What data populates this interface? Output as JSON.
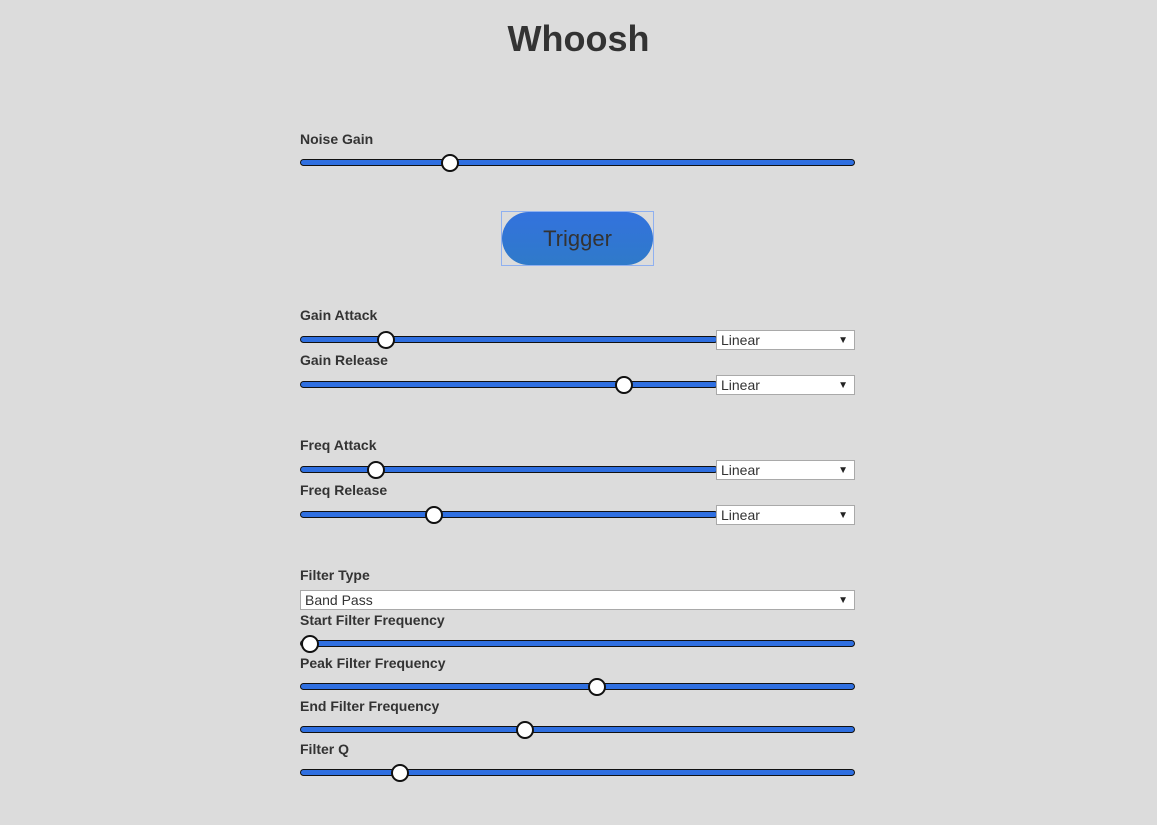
{
  "header": {
    "title": "Whoosh"
  },
  "noise_gain": {
    "label": "Noise Gain",
    "value": 0.26
  },
  "trigger": {
    "label": "Trigger"
  },
  "gain_attack": {
    "label": "Gain Attack",
    "value": 0.19,
    "curve": "Linear"
  },
  "gain_release": {
    "label": "Gain Release",
    "value": 0.785,
    "curve": "Linear"
  },
  "freq_attack": {
    "label": "Freq Attack",
    "value": 0.165,
    "curve": "Linear"
  },
  "freq_release": {
    "label": "Freq Release",
    "value": 0.31,
    "curve": "Linear"
  },
  "filter_type": {
    "label": "Filter Type",
    "value": "Band Pass"
  },
  "start_filter_frequency": {
    "label": "Start Filter Frequency",
    "value": 0.0
  },
  "peak_filter_frequency": {
    "label": "Peak Filter Frequency",
    "value": 0.535
  },
  "end_filter_frequency": {
    "label": "End Filter Frequency",
    "value": 0.4
  },
  "filter_q": {
    "label": "Filter Q",
    "value": 0.168
  },
  "colors": {
    "background": "#dcdcdc",
    "slider_track": "#2f6fe0",
    "button": "#3372de",
    "text": "#333333"
  }
}
